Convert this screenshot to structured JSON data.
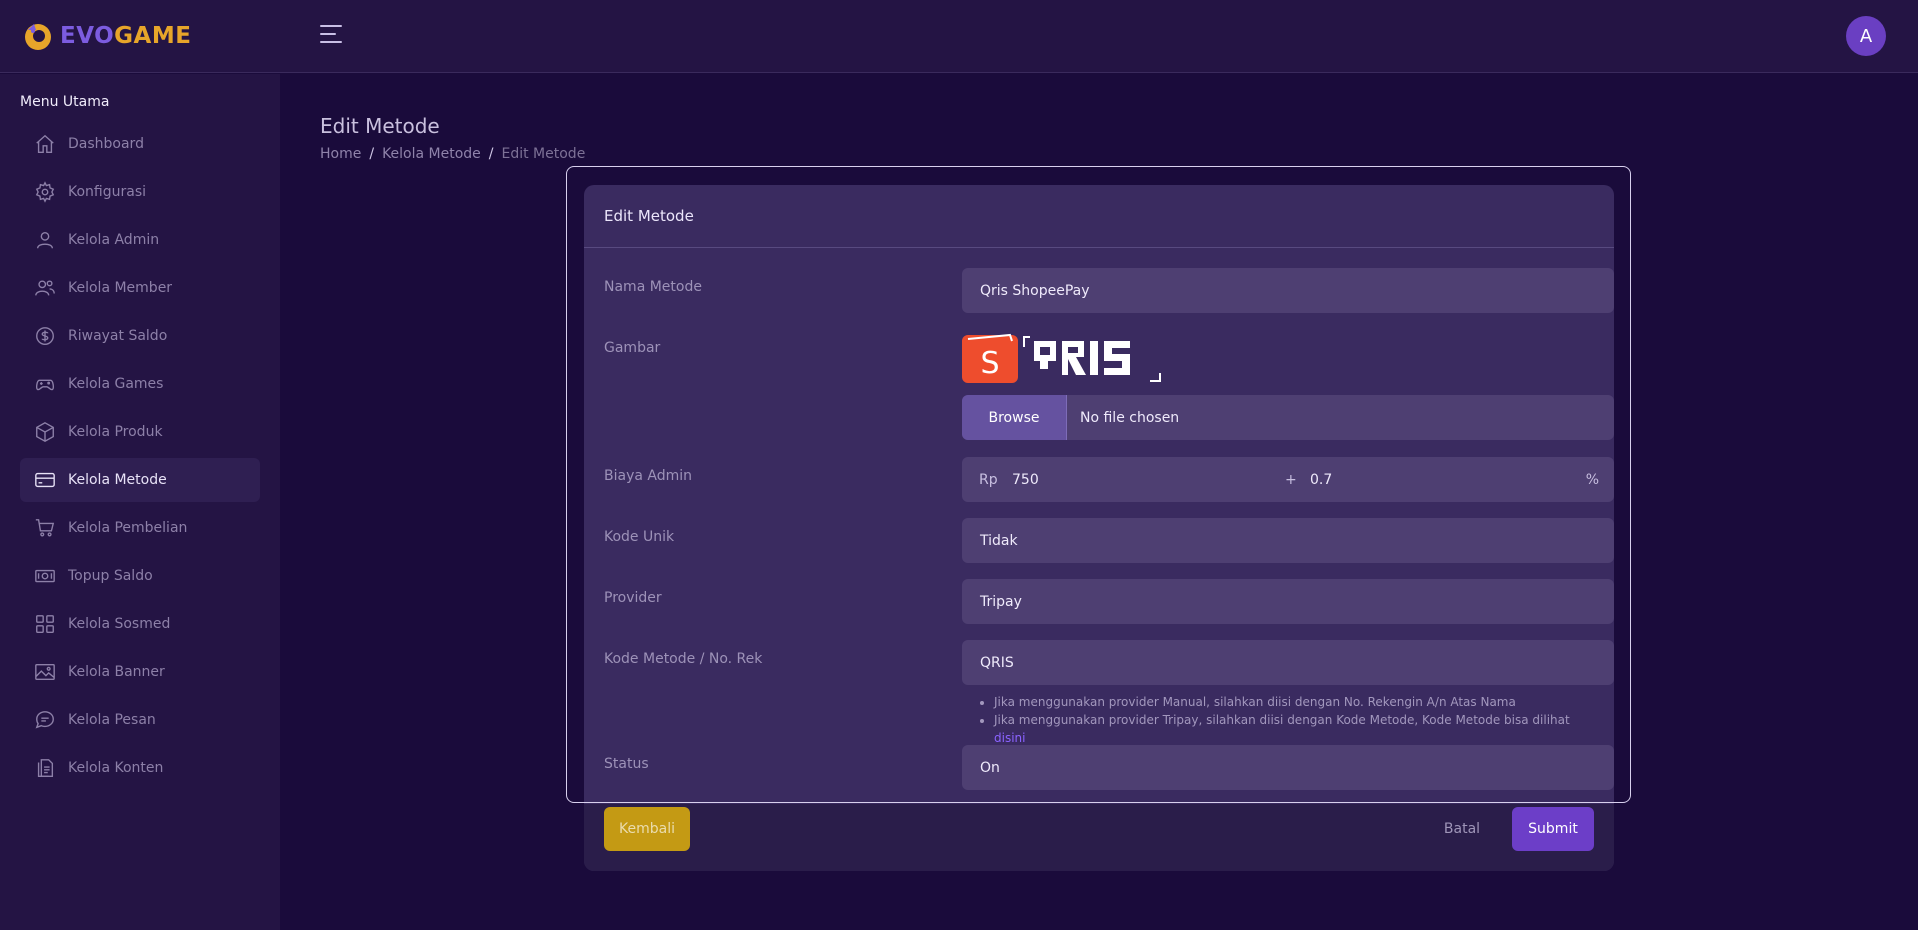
{
  "brand": {
    "part1": "EVO",
    "part2": "GAME",
    "color_primary": "#7c5ce0",
    "color_accent": "#e7a52a"
  },
  "header": {
    "menu_icon": "hamburger-icon",
    "avatar_initial": "A"
  },
  "sidebar": {
    "heading": "Menu Utama",
    "items": [
      {
        "label": "Dashboard",
        "icon": "home-icon"
      },
      {
        "label": "Konfigurasi",
        "icon": "gear-icon"
      },
      {
        "label": "Kelola Admin",
        "icon": "user-icon"
      },
      {
        "label": "Kelola Member",
        "icon": "users-icon"
      },
      {
        "label": "Riwayat Saldo",
        "icon": "dollar-icon"
      },
      {
        "label": "Kelola Games",
        "icon": "gamepad-icon"
      },
      {
        "label": "Kelola Produk",
        "icon": "box-icon"
      },
      {
        "label": "Kelola Metode",
        "icon": "card-icon"
      },
      {
        "label": "Kelola Pembelian",
        "icon": "cart-icon"
      },
      {
        "label": "Topup Saldo",
        "icon": "banknote-icon"
      },
      {
        "label": "Kelola Sosmed",
        "icon": "grid-icon"
      },
      {
        "label": "Kelola Banner",
        "icon": "image-icon"
      },
      {
        "label": "Kelola Pesan",
        "icon": "message-icon"
      },
      {
        "label": "Kelola Konten",
        "icon": "document-icon"
      }
    ],
    "active_label": "Kelola Metode"
  },
  "page": {
    "title": "Edit Metode",
    "breadcrumb": [
      "Home",
      "Kelola Metode",
      "Edit Metode"
    ],
    "breadcrumb_separator": "/"
  },
  "form": {
    "title": "Edit Metode",
    "nama_metode": {
      "label": "Nama Metode",
      "value": "Qris ShopeePay"
    },
    "gambar": {
      "label": "Gambar",
      "image_alt": "ShopeePay QRIS logo",
      "browse_label": "Browse",
      "file_status": "No file chosen"
    },
    "biaya_admin": {
      "label": "Biaya Admin",
      "prefix": "Rp",
      "fixed": "750",
      "plus": "+",
      "percent": "0.7",
      "suffix": "%"
    },
    "kode_unik": {
      "label": "Kode Unik",
      "value": "Tidak"
    },
    "provider": {
      "label": "Provider",
      "value": "Tripay"
    },
    "kode_metode": {
      "label": "Kode Metode / No. Rek",
      "value": "QRIS",
      "note1": "Jika menggunakan provider Manual, silahkan diisi dengan No. Rekengin A/n Atas Nama",
      "note2": "Jika menggunakan provider Tripay, silahkan diisi dengan Kode Metode, Kode Metode bisa dilihat",
      "note2_link": "disini"
    },
    "status": {
      "label": "Status",
      "value": "On"
    },
    "buttons": {
      "back": "Kembali",
      "cancel": "Batal",
      "submit": "Submit"
    }
  }
}
